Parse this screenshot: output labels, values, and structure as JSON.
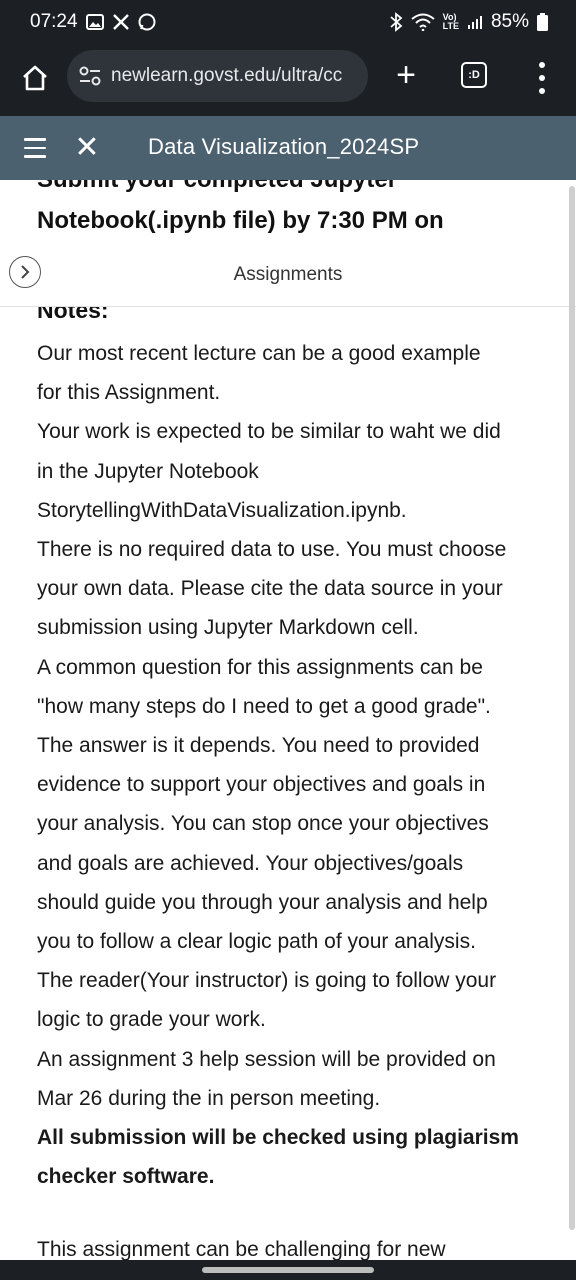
{
  "status_bar": {
    "time": "07:24",
    "battery": "85%",
    "lte_top": "Vo)",
    "lte_bottom": "LTE"
  },
  "browser": {
    "url": "newlearn.govst.edu/ultra/cc",
    "tabs_badge": ":D"
  },
  "course": {
    "title": "Data Visualization_2024SP"
  },
  "content": {
    "heading_cut": "Submit your completed Jupyter",
    "heading": "Notebook(.ipynb file) by 7:30 PM on",
    "assignments_label": "Assignments",
    "notes_label": "Notes:",
    "lines": [
      "Our most recent lecture can be a good example",
      "for this Assignment.",
      "Your work is expected to be similar to waht we did",
      "in the Jupyter Notebook",
      "StorytellingWithDataVisualization.ipynb.",
      "There is no required data to use. You must choose",
      "your own data. Please cite the data source in your",
      "submission using Jupyter Markdown cell.",
      "A common question for this assignments can be",
      "\"how many steps do I need to get a good grade\".",
      "The answer is it depends. You need to provided",
      "evidence to support your objectives and goals in",
      "your analysis. You can stop once your objectives",
      "and goals are achieved. Your objectives/goals",
      "should guide you through your analysis and help",
      "you to follow a clear logic path of your analysis.",
      "The reader(Your instructor) is going to follow your",
      "logic to grade your work.",
      "An assignment 3 help session will be provided on",
      "Mar 26 during the in person meeting."
    ],
    "bold_lines": [
      "All submission will be checked using plagiarism",
      "checker software."
    ],
    "cut_bottom": "This assignment can be challenging for new"
  }
}
